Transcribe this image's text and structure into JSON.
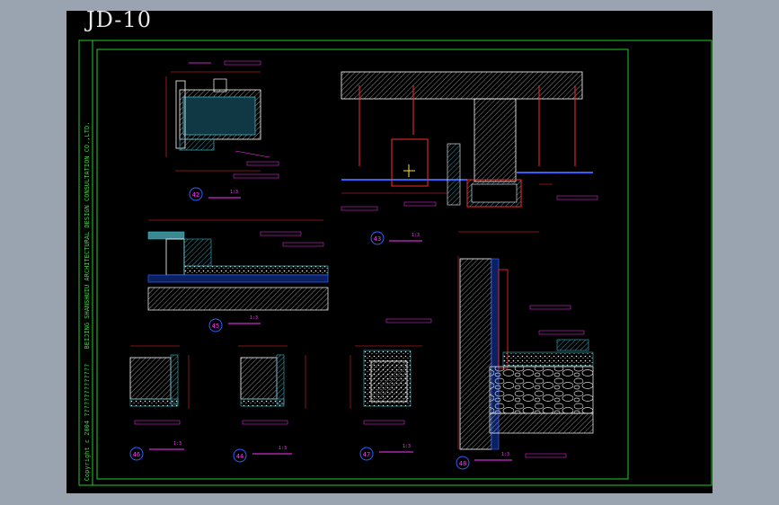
{
  "drawing": {
    "title": "JD-10",
    "company_block": "BEIJING SHANSHUIU ARCHITECTURAL DESIGN CONSULTATION CO.,LTD.",
    "copyright": "Copyright  c  2004  ??????????????",
    "scale_label": "1:3",
    "detail_numbers": [
      "42",
      "43",
      "45",
      "46",
      "44",
      "47",
      "48"
    ],
    "colors": {
      "background": "#000000",
      "frame": "#22cc22",
      "outline": "#ffffff",
      "dimension": "#ff2a2a",
      "annotation": "#ff33ff",
      "hatch_cyan": "#38b8c8",
      "grey": "#b0b0b0",
      "yellow": "#ffe040",
      "blue": "#3060ff"
    }
  }
}
